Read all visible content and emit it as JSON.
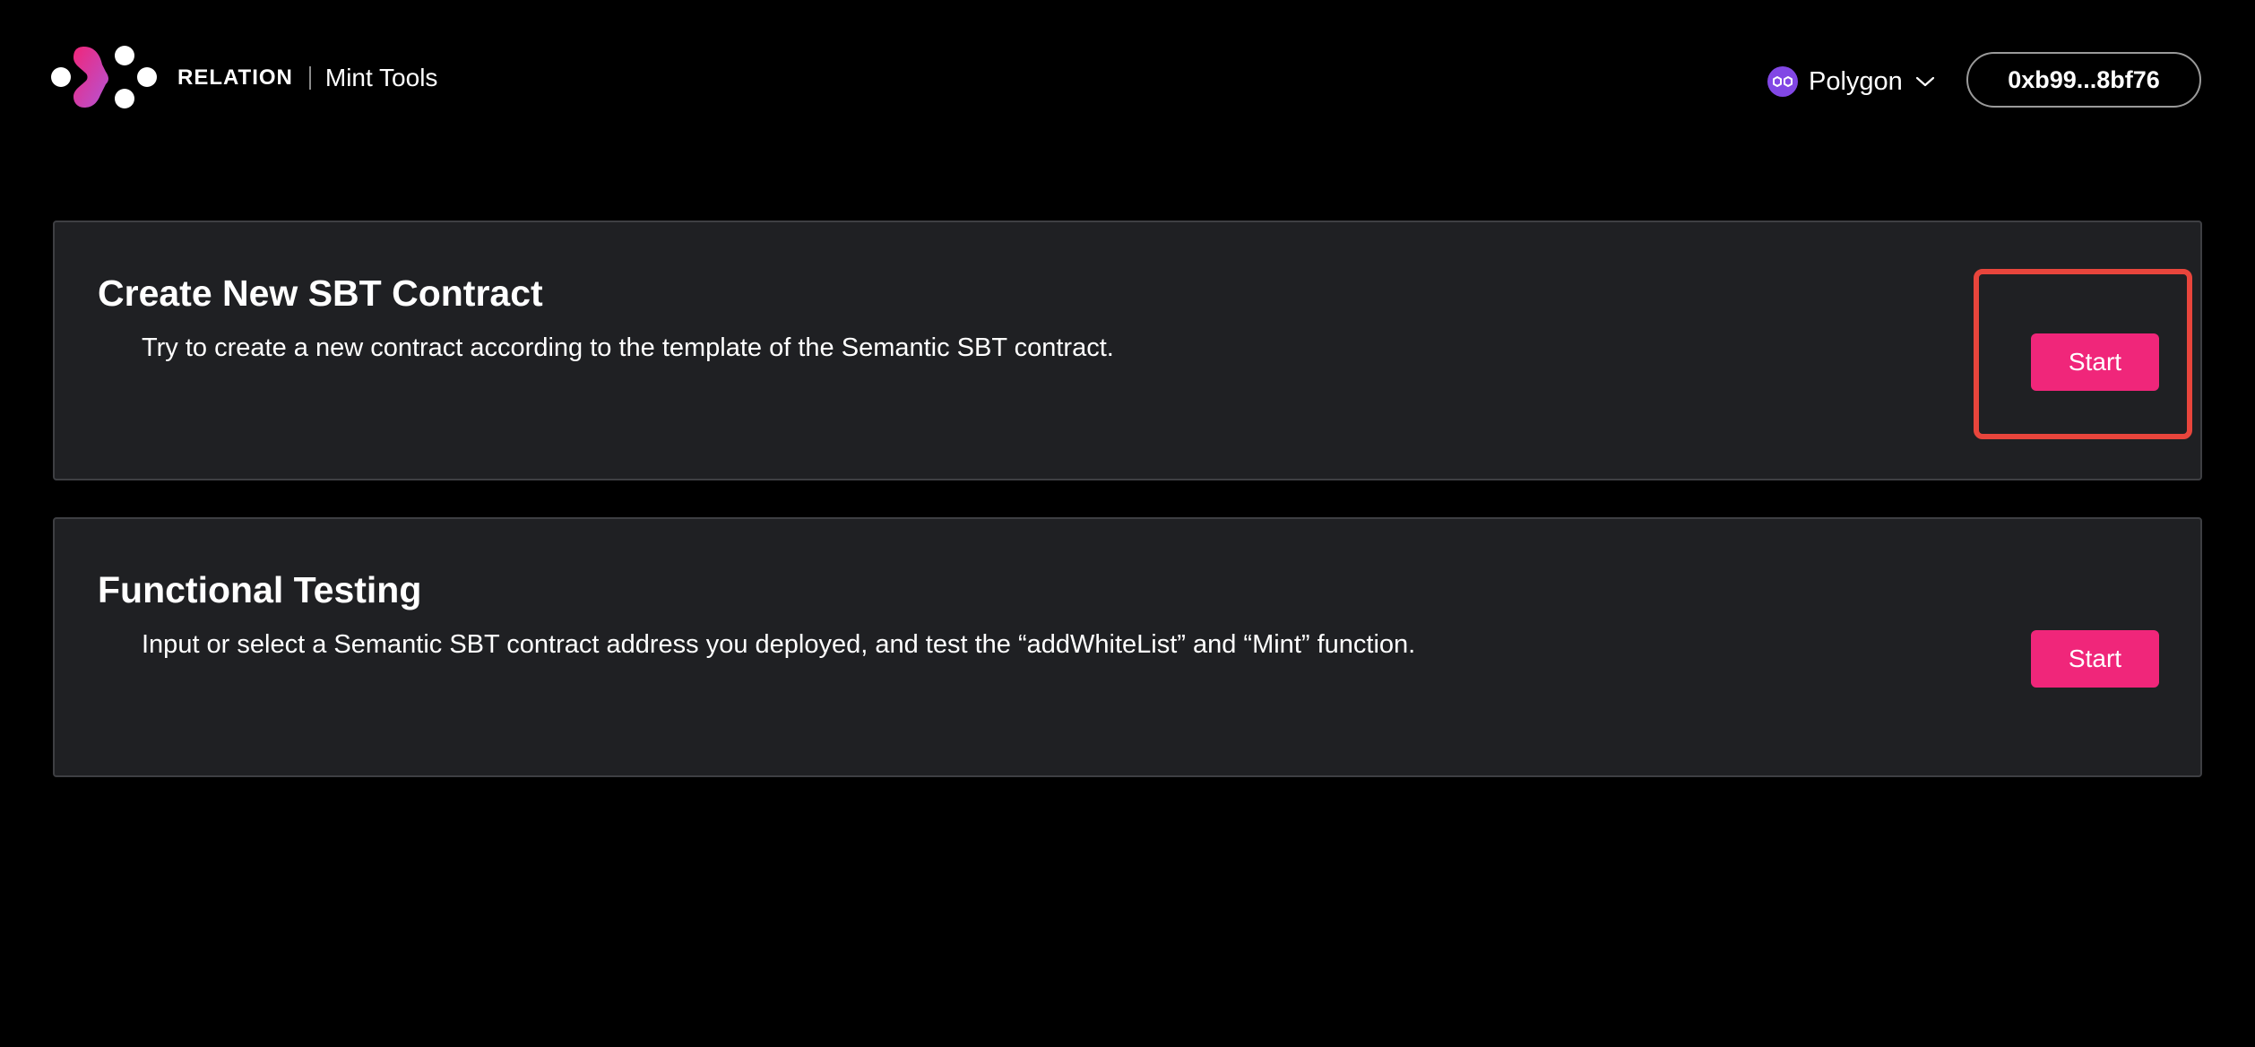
{
  "header": {
    "brand_name": "RELATION",
    "product_name": "Mint Tools",
    "logo_icon": "relation-logo-icon",
    "network": {
      "label": "Polygon",
      "icon": "polygon-icon",
      "icon_color": "#8247e5"
    },
    "wallet_address": "0xb99...8bf76"
  },
  "cards": [
    {
      "title": "Create New SBT Contract",
      "description": "Try to create a new contract according to the template of the Semantic SBT contract.",
      "button_label": "Start",
      "highlighted": true
    },
    {
      "title": "Functional Testing",
      "description": "Input or select a Semantic SBT contract address you deployed, and test the “addWhiteList” and “Mint” function.",
      "button_label": "Start",
      "highlighted": false
    }
  ],
  "colors": {
    "background": "#000000",
    "card_background": "#1f2023",
    "accent": "#f0267a",
    "highlight_box": "#e8453c"
  }
}
